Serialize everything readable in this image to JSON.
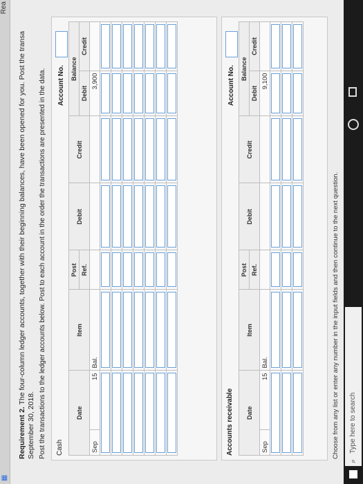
{
  "header": {
    "corner_text": "Rea"
  },
  "requirement": {
    "label": "Requirement 2.",
    "text": " The four-column ledger accounts, together with their beginning balances, have been opened for you. Post the transa",
    "line2": "September 30, 2018."
  },
  "instruction": "Post the transactions to the ledger accounts below. Post to each account in the order the transactions are presented in the data.",
  "columns": {
    "date": "Date",
    "item": "Item",
    "post": "Post",
    "ref": "Ref.",
    "debit": "Debit",
    "credit": "Credit",
    "balance": "Balance",
    "bal_debit": "Debit",
    "bal_credit": "Credit"
  },
  "account_no_label": "Account No.",
  "cash": {
    "title": "Cash",
    "first_row": {
      "month": "Sep",
      "day": "15",
      "item": "Bal.",
      "balance_debit": "3,900"
    }
  },
  "accounts_receivable": {
    "title": "Accounts receivable",
    "first_row": {
      "month": "Sep",
      "day": "15",
      "item": "Bal.",
      "balance_debit": "9,100"
    }
  },
  "footer_note": "Choose from any list or enter any number in the input fields and then continue to the next question.",
  "taskbar": {
    "search_placeholder": "Type here to search"
  }
}
